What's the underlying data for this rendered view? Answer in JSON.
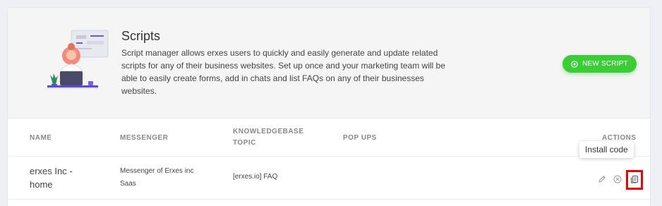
{
  "header": {
    "title": "Scripts",
    "description": "Script manager allows erxes users to quickly and easily generate and update related scripts for any of their business websites. Set up once and your marketing team will be able to easily create forms, add in chats and list FAQs on any of their businesses websites."
  },
  "new_script_button": {
    "label": "NEW SCRIPT",
    "icon": "plus-circle-icon"
  },
  "table": {
    "columns": [
      "NAME",
      "MESSENGER",
      "KNOWLEDGEBASE TOPIC",
      "POP UPS",
      "ACTIONS"
    ],
    "rows": [
      {
        "name": "erxes Inc - home",
        "messenger": "Messenger of Erxes inc Saas",
        "knowledgebase_topic": "[erxes.io] FAQ",
        "pop_ups": "",
        "actions": [
          "edit-icon",
          "delete-icon",
          "install-code-icon"
        ]
      }
    ]
  },
  "tooltip": {
    "text": "Install code"
  },
  "colors": {
    "accent_green": "#3ccc38",
    "highlight_red": "#e00000"
  }
}
